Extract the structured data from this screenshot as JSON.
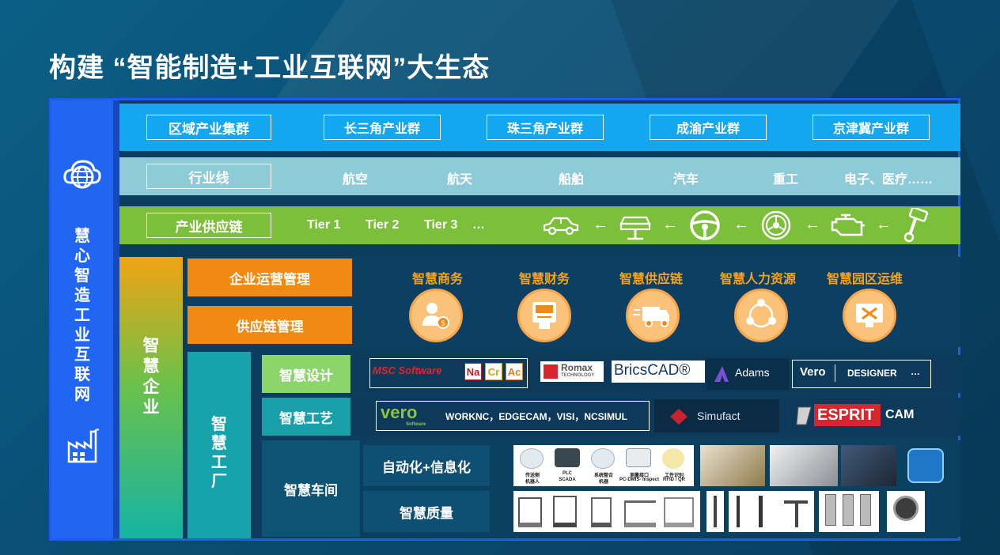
{
  "title": "构建 “智能制造+工业互联网”大生态",
  "left_column": {
    "label": "慧心智造工业互联网"
  },
  "regions": {
    "header": "区域产业集群",
    "items": [
      "长三角产业群",
      "珠三角产业群",
      "成渝产业群",
      "京津冀产业群"
    ]
  },
  "industries": {
    "header": "行业线",
    "items": [
      "航空",
      "航天",
      "船舶",
      "汽车",
      "重工",
      "电子、医疗……"
    ]
  },
  "supply_chain": {
    "header": "产业供应链",
    "tiers": [
      "Tier 1",
      "Tier 2",
      "Tier 3",
      "…"
    ],
    "arrow": "←"
  },
  "enterprise": {
    "label": "智慧企业",
    "ops": "企业运营管理",
    "scm": "供应链管理",
    "services": [
      "智慧商务",
      "智慧财务",
      "智慧供应链",
      "智慧人力资源",
      "智慧园区运维"
    ]
  },
  "factory": {
    "label": "智慧工厂",
    "design": {
      "label": "智慧设计",
      "software": [
        "MSC Software",
        "Na",
        "Cr",
        "Ac",
        "Romax",
        "TECHNOLOGY",
        "BricsCAD®",
        "Adams",
        "Vero",
        "DESIGNER",
        "…"
      ]
    },
    "craft": {
      "label": "智慧工艺",
      "vero": "vero",
      "vero_sub": "Software",
      "software_list": "WORKNC，EDGECAM，VISI，NCSIMUL",
      "simufact": "Simufact",
      "esprit": "ESPRIT",
      "cam": "CAM"
    },
    "workshop": {
      "label": "智慧车间",
      "automation": {
        "label": "自动化+信息化",
        "items": [
          [
            "传送侧",
            "机器人"
          ],
          [
            "PLC",
            "SCADA"
          ],
          [
            "系统整合",
            "机器"
          ],
          [
            "测量接口",
            "PC-DMIS- Inspect"
          ],
          [
            "工件识别",
            "RFID / QR"
          ]
        ]
      },
      "quality": {
        "label": "智慧质量"
      }
    }
  },
  "colors": {
    "frame": "#1e5cf0",
    "region_row": "#12a7ee",
    "industry_row": "#8ecbd9",
    "supply_row": "#7cbf3a",
    "orange": "#f08a12",
    "service_text": "#f5a21d"
  }
}
